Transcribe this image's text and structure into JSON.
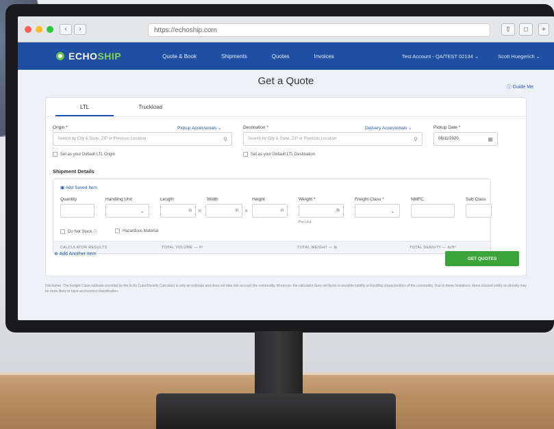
{
  "browser": {
    "url": "https://echoship.com"
  },
  "app": {
    "logo_main": "ECHO",
    "logo_accent": "SHIP",
    "nav": [
      "Quote & Book",
      "Shipments",
      "Quotes",
      "Invoices"
    ],
    "account": "Test Account - QA/TEST 02134",
    "user": "Scott Huegerich"
  },
  "page": {
    "title": "Get a Quote",
    "guide": "Guide Me"
  },
  "tabs": [
    "LTL",
    "Truckload"
  ],
  "form": {
    "origin_label": "Origin *",
    "pickup_acc": "Pickup Accessorials",
    "origin_placeholder": "Search by City & State, ZIP or Previous Location",
    "origin_default": "Set as your Default LTL Origin",
    "destination_label": "Destination *",
    "delivery_acc": "Delivery Accessorials",
    "destination_placeholder": "Search by City & State, ZIP or Previous Location",
    "destination_default": "Set as your Default LTL Destination",
    "pickup_date_label": "Pickup Date *",
    "pickup_date_value": "08/11/2020"
  },
  "shipment": {
    "heading": "Shipment Details",
    "add_saved": "Add Saved Item",
    "quantity": "Quantity",
    "handling_unit": "Handling Unit",
    "length": "Length",
    "width": "Width",
    "height": "Height",
    "weight": "Weight *",
    "freight_class": "Freight Class *",
    "nmfc": "NMFC",
    "sub_class": "Sub Class",
    "unit_in": "in",
    "unit_lb": "lb",
    "per_unit": "Per Unit",
    "do_not_stack": "Do Not Stack",
    "hazardous": "Hazardous Material",
    "calc_results": "CALCULATOR RESULTS",
    "total_volume": "TOTAL VOLUME — ft³",
    "total_weight": "TOTAL WEIGHT — lb",
    "total_density": "TOTAL DENSITY — lb/ft³"
  },
  "actions": {
    "add_another": "Add Another Item",
    "get_quotes": "GET QUOTES"
  },
  "disclaimer": "Disclaimer: The Freight Class estimate provided by the Echo Cube/Density Calculator is only an estimate and does not take into account the commodity. Moreover, the calculator does not factor in possible liability or handling characteristics of the commodity. Due to these limitations, items classed solely on density may be more likely to have an incorrect classification."
}
